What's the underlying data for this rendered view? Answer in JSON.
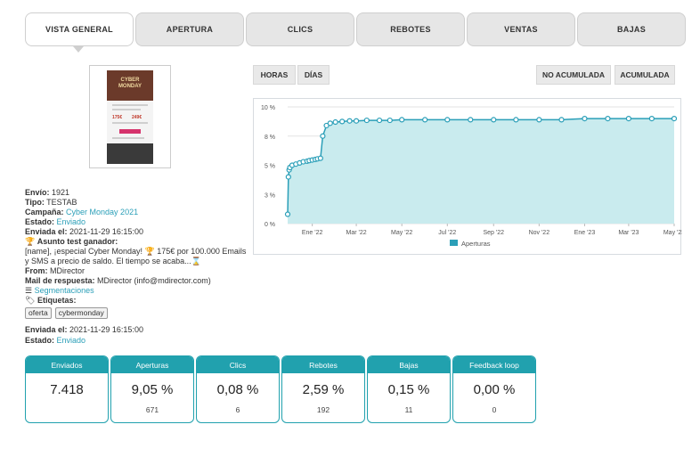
{
  "tabs": [
    "VISTA GENERAL",
    "APERTURA",
    "CLICS",
    "REBOTES",
    "VENTAS",
    "BAJAS"
  ],
  "thumbnail": {
    "title_line1": "CYBER",
    "title_line2": "MONDAY"
  },
  "info": {
    "envio_label": "Envío:",
    "envio_value": "1921",
    "tipo_label": "Tipo:",
    "tipo_value": "TESTAB",
    "campana_label": "Campaña:",
    "campana_value": "Cyber Monday 2021",
    "estado_label": "Estado:",
    "estado_value": "Enviado",
    "enviada_label": "Enviada el:",
    "enviada_value": "2021-11-29 16:15:00",
    "asunto_label": "Asunto test ganador:",
    "asunto_line1": "[name], ¡especial Cyber Monday! 🏆 175€ por 100.000 Emails",
    "asunto_line2": "y SMS a precio de saldo. El tiempo se acaba...⌛",
    "from_label": "From:",
    "from_value": "MDirector",
    "mail_label": "Mail de respuesta:",
    "mail_value": "MDirector (info@mdirector.com)",
    "segmentaciones": "Segmentaciones",
    "etiquetas_label": "Etiquetas:",
    "tags": [
      "oferta",
      "cybermonday"
    ],
    "enviada2_label": "Enviada el:",
    "enviada2_value": "2021-11-29 16:15:00",
    "estado2_label": "Estado:",
    "estado2_value": "Enviado"
  },
  "chart_buttons": {
    "horas": "HORAS",
    "dias": "DÍAS",
    "no_acumulada": "NO ACUMULADA",
    "acumulada": "ACUMULADA"
  },
  "chart_data": {
    "type": "area",
    "ylim": [
      0,
      10
    ],
    "yticks": [
      "0 %",
      "3 %",
      "5 %",
      "8 %",
      "10 %"
    ],
    "xticks": [
      "Ene '22",
      "Mar '22",
      "May '22",
      "Jul '22",
      "Sep '22",
      "Nov '22",
      "Ene '23",
      "Mar '23",
      "May '23"
    ],
    "legend": "Aperturas",
    "colors": {
      "line": "#2b9fb8",
      "fill": "#c9ebee"
    },
    "series": [
      {
        "name": "Aperturas",
        "x": [
          "2021-11-29",
          "2021-11-30",
          "2021-12-01",
          "2021-12-02",
          "2021-12-05",
          "2021-12-10",
          "2021-12-15",
          "2021-12-20",
          "2021-12-25",
          "2021-12-28",
          "2022-01-01",
          "2022-01-05",
          "2022-01-08",
          "2022-01-12",
          "2022-01-15",
          "2022-01-20",
          "2022-01-25",
          "2022-02-01",
          "2022-02-10",
          "2022-02-20",
          "2022-03-01",
          "2022-03-15",
          "2022-04-01",
          "2022-04-15",
          "2022-05-01",
          "2022-06-01",
          "2022-07-01",
          "2022-08-01",
          "2022-09-01",
          "2022-10-01",
          "2022-11-01",
          "2022-12-01",
          "2023-01-01",
          "2023-02-01",
          "2023-03-01",
          "2023-04-01",
          "2023-05-01"
        ],
        "values": [
          0.8,
          4.0,
          4.6,
          4.8,
          5.0,
          5.1,
          5.2,
          5.3,
          5.35,
          5.4,
          5.45,
          5.5,
          5.55,
          5.6,
          7.5,
          8.4,
          8.6,
          8.7,
          8.75,
          8.8,
          8.8,
          8.85,
          8.85,
          8.85,
          8.9,
          8.9,
          8.9,
          8.9,
          8.9,
          8.9,
          8.9,
          8.9,
          9.0,
          9.0,
          9.0,
          9.0,
          9.0
        ]
      }
    ]
  },
  "cards": [
    {
      "title": "Enviados",
      "value": "7.418",
      "sub": ""
    },
    {
      "title": "Aperturas",
      "value": "9,05 %",
      "sub": "671"
    },
    {
      "title": "Clics",
      "value": "0,08 %",
      "sub": "6"
    },
    {
      "title": "Rebotes",
      "value": "2,59 %",
      "sub": "192"
    },
    {
      "title": "Bajas",
      "value": "0,15 %",
      "sub": "11"
    },
    {
      "title": "Feedback loop",
      "value": "0,00 %",
      "sub": "0"
    }
  ]
}
